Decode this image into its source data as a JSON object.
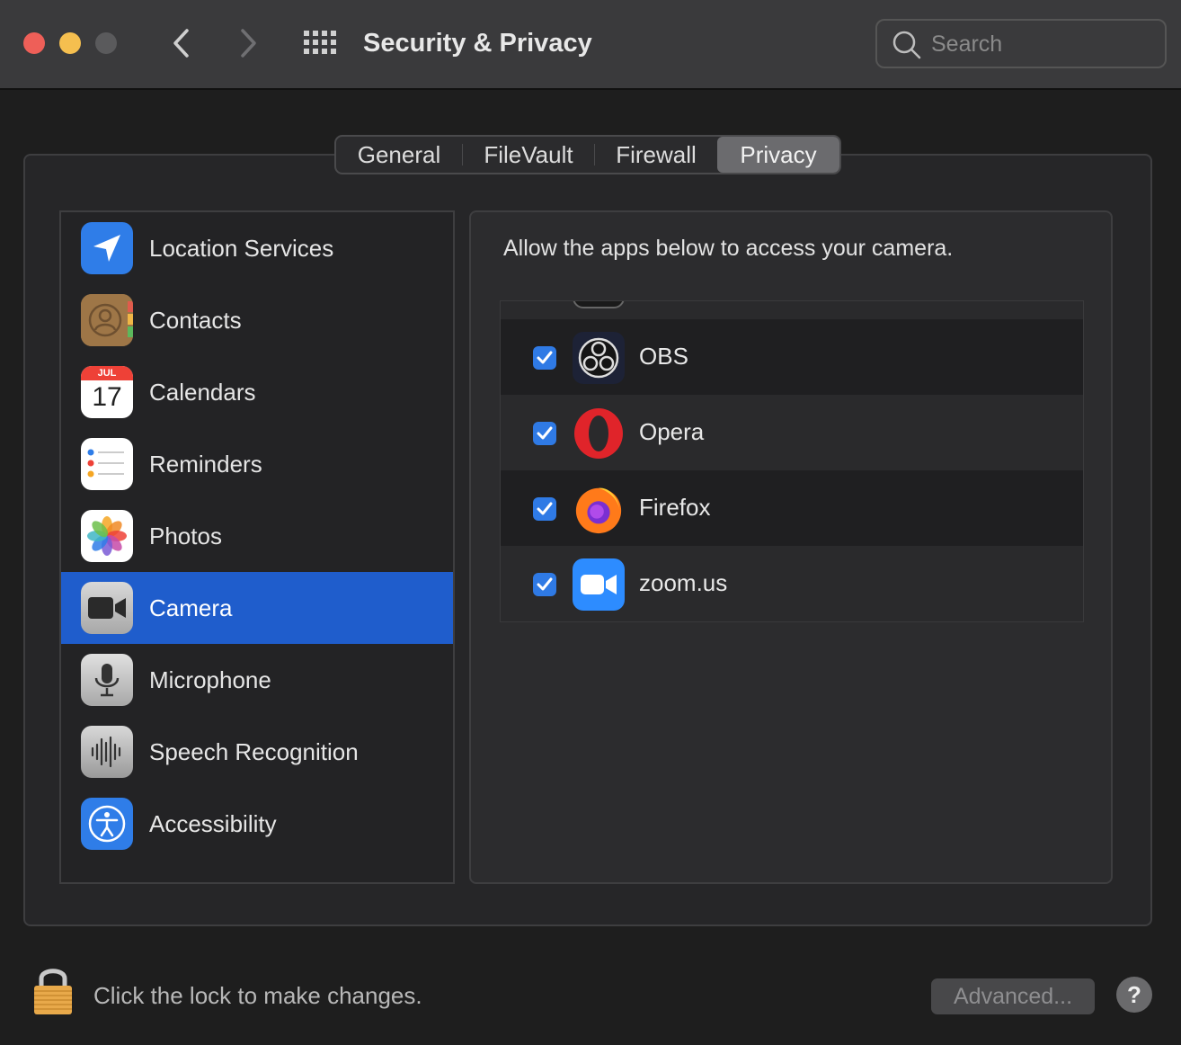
{
  "window": {
    "title": "Security & Privacy"
  },
  "search": {
    "placeholder": "Search"
  },
  "tabs": [
    {
      "label": "General",
      "active": false
    },
    {
      "label": "FileVault",
      "active": false
    },
    {
      "label": "Firewall",
      "active": false
    },
    {
      "label": "Privacy",
      "active": true
    }
  ],
  "sidebar": {
    "items": [
      {
        "label": "Location Services",
        "icon": "location-arrow-icon",
        "selected": false
      },
      {
        "label": "Contacts",
        "icon": "contacts-icon",
        "selected": false
      },
      {
        "label": "Calendars",
        "icon": "calendar-icon",
        "selected": false,
        "calendar_month": "JUL",
        "calendar_day": "17"
      },
      {
        "label": "Reminders",
        "icon": "reminders-icon",
        "selected": false
      },
      {
        "label": "Photos",
        "icon": "photos-icon",
        "selected": false
      },
      {
        "label": "Camera",
        "icon": "camera-icon",
        "selected": true
      },
      {
        "label": "Microphone",
        "icon": "microphone-icon",
        "selected": false
      },
      {
        "label": "Speech Recognition",
        "icon": "speech-waveform-icon",
        "selected": false
      },
      {
        "label": "Accessibility",
        "icon": "accessibility-icon",
        "selected": false
      }
    ]
  },
  "camera_pane": {
    "description": "Allow the apps below to access your camera.",
    "apps": [
      {
        "name": "OBS",
        "checked": true,
        "icon": "obs-icon"
      },
      {
        "name": "Opera",
        "checked": true,
        "icon": "opera-icon"
      },
      {
        "name": "Firefox",
        "checked": true,
        "icon": "firefox-icon"
      },
      {
        "name": "zoom.us",
        "checked": true,
        "icon": "zoom-icon"
      }
    ]
  },
  "footer": {
    "lock_text": "Click the lock to make changes.",
    "advanced_label": "Advanced...",
    "help_label": "?"
  },
  "colors": {
    "selection": "#1f5dcc",
    "checkbox": "#2f7ae5",
    "close": "#ee5f58",
    "minimize": "#f5bf4f"
  }
}
